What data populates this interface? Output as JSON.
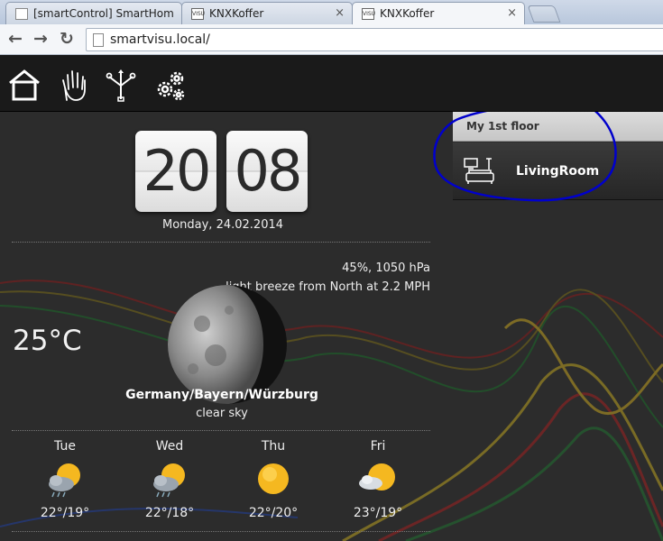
{
  "browser": {
    "tabs": [
      {
        "title": "[smartControl] SmartHom",
        "icon": "page-icon",
        "active": false
      },
      {
        "title": "KNXKoffer",
        "icon": "visu-favicon",
        "active": false
      },
      {
        "title": "KNXKoffer",
        "icon": "visu-favicon",
        "active": true
      }
    ],
    "url": "smartvisu.local/",
    "favicon_label": "VISU"
  },
  "header": {
    "icons": [
      "home-icon",
      "hand-icon",
      "network-icon",
      "gears-icon"
    ]
  },
  "clock": {
    "hours": "20",
    "minutes": "08",
    "date": "Monday, 24.02.2014"
  },
  "weather": {
    "humidity_pressure": "45%, 1050 hPa",
    "wind": "light breeze from North at 2.2 MPH",
    "temperature": "25°C",
    "location": "Germany/Bayern/Würzburg",
    "condition": "clear sky",
    "forecast": [
      {
        "day": "Tue",
        "temps": "22°/19°",
        "icon": "sun-cloud-rain-icon"
      },
      {
        "day": "Wed",
        "temps": "22°/18°",
        "icon": "sun-cloud-rain-icon"
      },
      {
        "day": "Thu",
        "temps": "22°/20°",
        "icon": "sun-icon"
      },
      {
        "day": "Fri",
        "temps": "23°/19°",
        "icon": "sun-cloud-icon"
      }
    ]
  },
  "floor": {
    "title": "My 1st floor",
    "rooms": [
      {
        "label": "LivingRoom",
        "icon": "living-room-icon"
      }
    ]
  },
  "colors": {
    "accent_annotation": "#0000cc",
    "header_bg": "#1a1a1a",
    "page_bg": "#2c2c2c"
  }
}
